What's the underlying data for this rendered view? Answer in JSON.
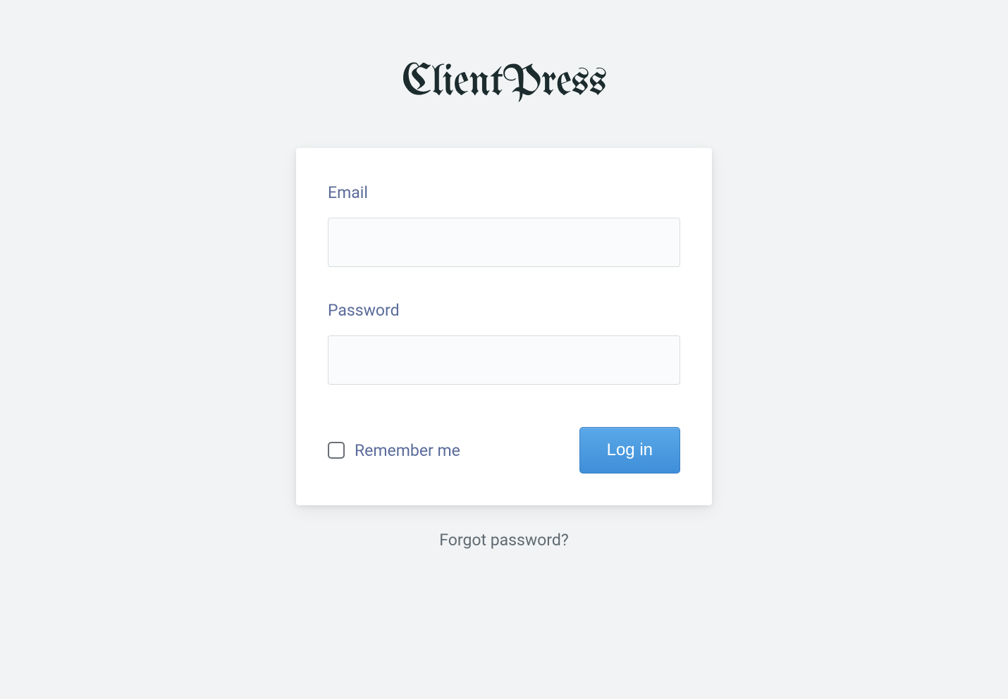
{
  "logo": "ClientPress",
  "form": {
    "email_label": "Email",
    "email_value": "",
    "password_label": "Password",
    "password_value": "",
    "remember_label": "Remember me",
    "remember_checked": false,
    "submit_label": "Log in"
  },
  "forgot_link": "Forgot password?"
}
